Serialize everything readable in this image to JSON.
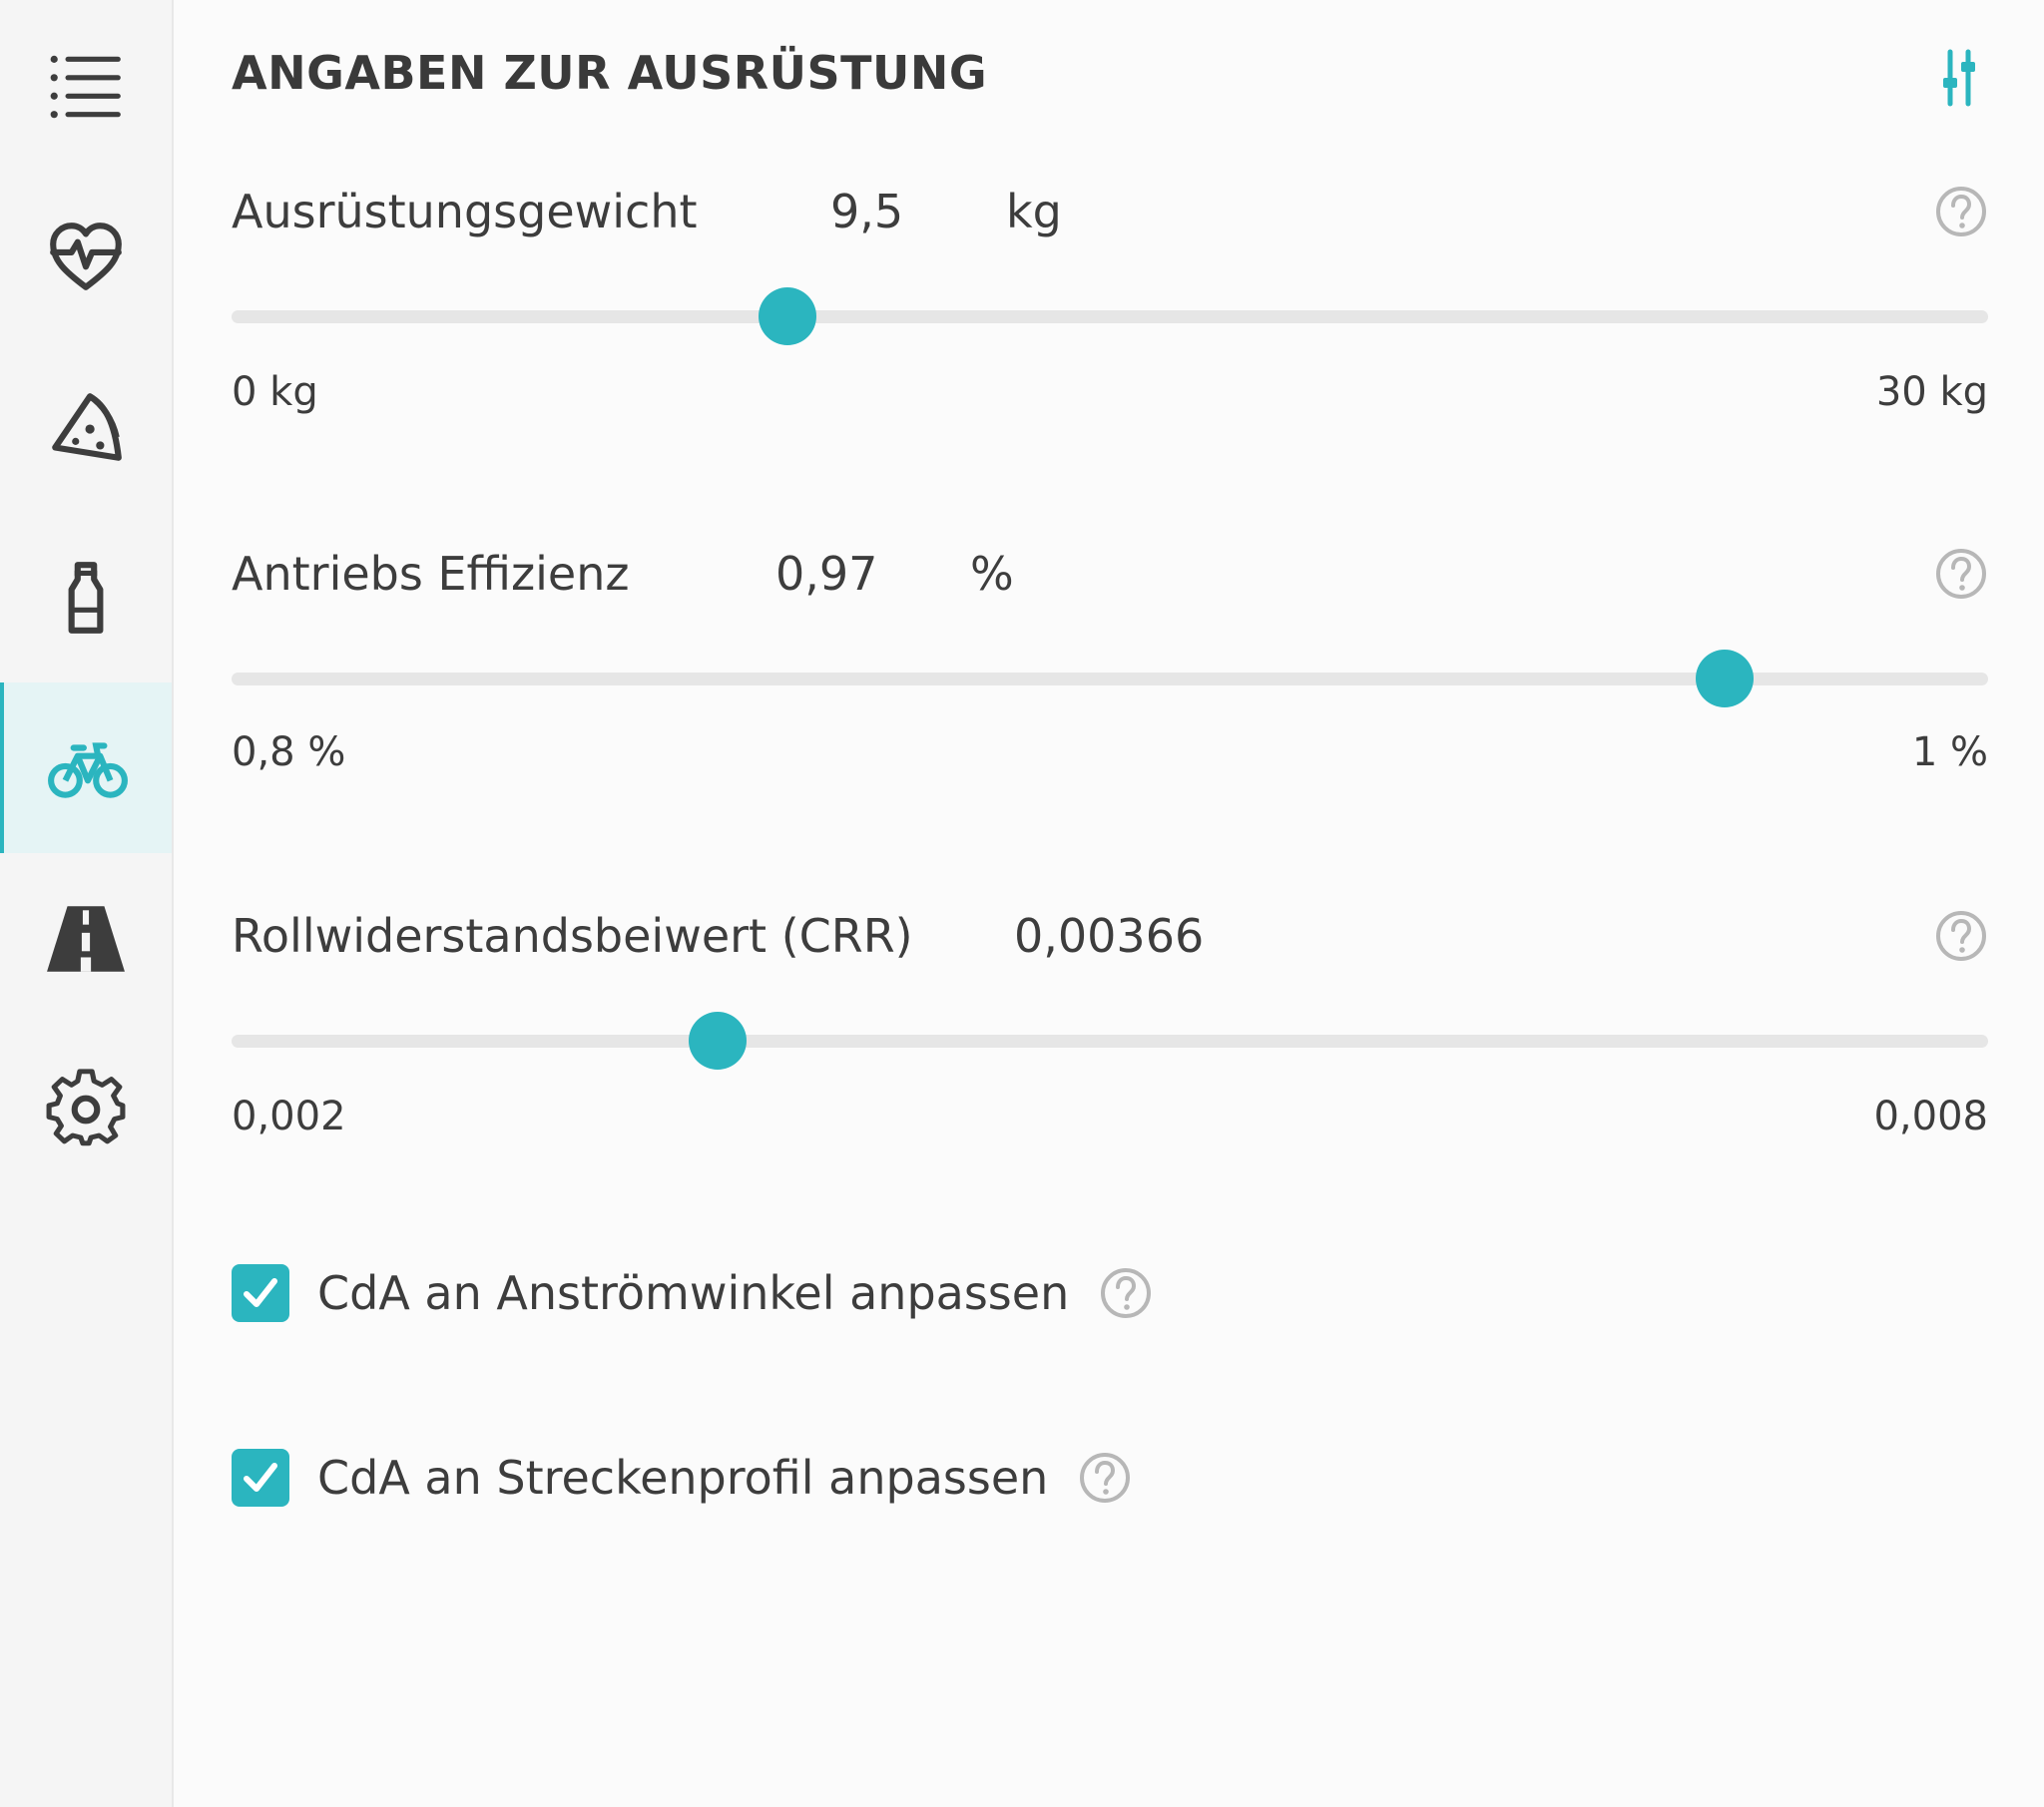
{
  "sidebar": {
    "items": [
      {
        "icon": "menu-list-icon"
      },
      {
        "icon": "heart-pulse-icon"
      },
      {
        "icon": "pizza-slice-icon"
      },
      {
        "icon": "bottle-icon"
      },
      {
        "icon": "bicycle-icon",
        "active": true
      },
      {
        "icon": "road-icon"
      },
      {
        "icon": "gear-icon"
      }
    ]
  },
  "header": {
    "title": "ANGABEN ZUR AUSRÜSTUNG",
    "filter_icon": "sliders-icon"
  },
  "fields": [
    {
      "label": "Ausrüstungsgewicht",
      "value": "9,5",
      "unit": "kg",
      "min_label": "0 kg",
      "max_label": "30 kg",
      "min": 0,
      "max": 30,
      "current": 9.5
    },
    {
      "label": "Antriebs Effizienz",
      "value": "0,97",
      "unit": "%",
      "min_label": "0,8 %",
      "max_label": "1 %",
      "min": 0.8,
      "max": 1,
      "current": 0.97
    },
    {
      "label": "Rollwiderstandsbeiwert (CRR)",
      "value": "0,00366",
      "unit": "",
      "min_label": "0,002",
      "max_label": "0,008",
      "min": 0.002,
      "max": 0.008,
      "current": 0.00366
    }
  ],
  "checkboxes": [
    {
      "label": "CdA an Anströmwinkel anpassen",
      "checked": true
    },
    {
      "label": "CdA an Streckenprofil anpassen",
      "checked": true
    }
  ],
  "colors": {
    "accent": "#2bb5bf",
    "text": "#3d3d3d",
    "track": "#e6e6e6",
    "active_bg": "#e5f4f5"
  }
}
